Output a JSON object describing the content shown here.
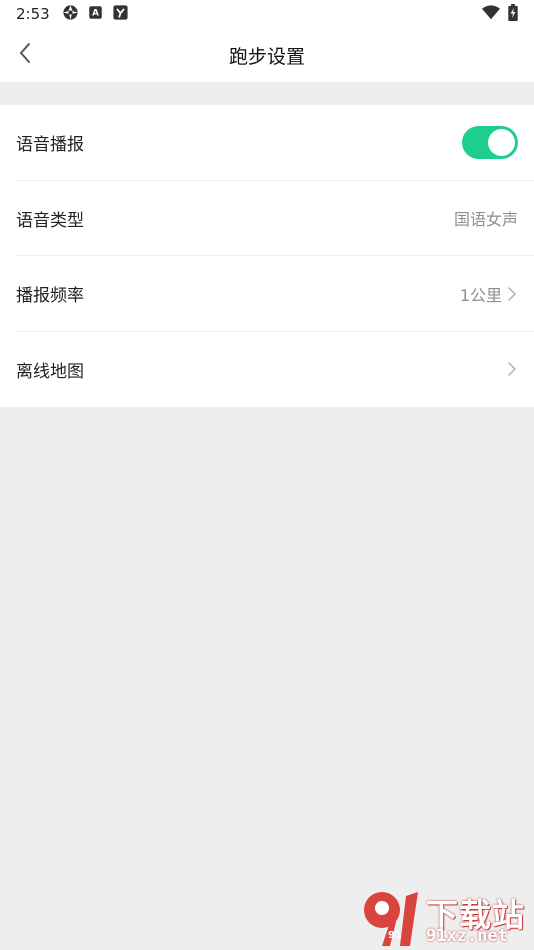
{
  "status_bar": {
    "time": "2:53",
    "left_icons": [
      "aperture-icon",
      "a-box-icon",
      "y-box-icon"
    ],
    "right_icons": [
      "wifi-icon",
      "battery-charging-icon"
    ]
  },
  "header": {
    "title": "跑步设置",
    "back_icon": "chevron-left-icon"
  },
  "settings": {
    "voice_broadcast": {
      "label": "语音播报",
      "enabled": true
    },
    "voice_type": {
      "label": "语音类型",
      "value": "国语女声"
    },
    "broadcast_frequency": {
      "label": "播报频率",
      "value": "1公里"
    },
    "offline_map": {
      "label": "离线地图"
    }
  },
  "watermark": {
    "main": "下载站",
    "sub": "91xz.net",
    "logo_text": "91"
  },
  "colors": {
    "accent": "#1ECE8E",
    "background": "#EEEEEE",
    "watermark_red": "#D9443F"
  }
}
